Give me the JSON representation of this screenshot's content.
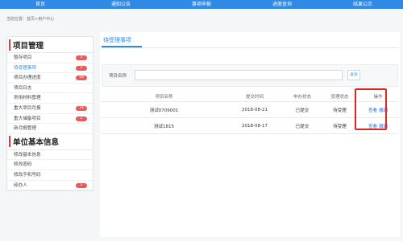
{
  "nav": [
    "首页",
    "通知公告",
    "事项申报",
    "进度查询",
    "结果公示"
  ],
  "breadcrumb": "当前位置：首页>用户中心",
  "sidebar": {
    "sections": [
      {
        "title": "项目管理",
        "items": [
          {
            "label": "暂存项目",
            "badge": "2"
          },
          {
            "label": "待受理事项",
            "badge": "2",
            "active": true
          },
          {
            "label": "项目办理进度",
            "badge": "16"
          },
          {
            "label": "项目日志",
            "badge": ""
          },
          {
            "label": "常用材料管理",
            "badge": ""
          },
          {
            "label": "重大项目月报",
            "badge": "14"
          },
          {
            "label": "重大储备项目",
            "badge": "2"
          },
          {
            "label": "新月报管理",
            "badge": ""
          }
        ]
      },
      {
        "title": "单位基本信息",
        "items": [
          {
            "label": "修改基本信息",
            "badge": ""
          },
          {
            "label": "修改密码",
            "badge": ""
          },
          {
            "label": "修改手机号码",
            "badge": ""
          },
          {
            "label": "经办人",
            "badge": "2"
          }
        ]
      }
    ]
  },
  "main": {
    "tab": "待受理事项",
    "search": {
      "label": "项目名称",
      "value": "",
      "button": "查询"
    },
    "table": {
      "headers": [
        "项目名称",
        "提交时间",
        "申办状态",
        "受理状态",
        "操作"
      ],
      "rows": [
        {
          "name": "测试0709001",
          "time": "2018-08-21",
          "status": "已提交",
          "accept": "待受理",
          "ops": [
            "查看",
            "撤回"
          ]
        },
        {
          "name": "测试1815",
          "time": "2018-08-17",
          "status": "已提交",
          "accept": "待受理",
          "ops": [
            "查看",
            "撤回"
          ]
        }
      ]
    }
  },
  "colors": {
    "nav": "#2f8ae6",
    "accent": "#e03a3a",
    "badge": "#e75b5b",
    "link": "#2f6fd6"
  }
}
